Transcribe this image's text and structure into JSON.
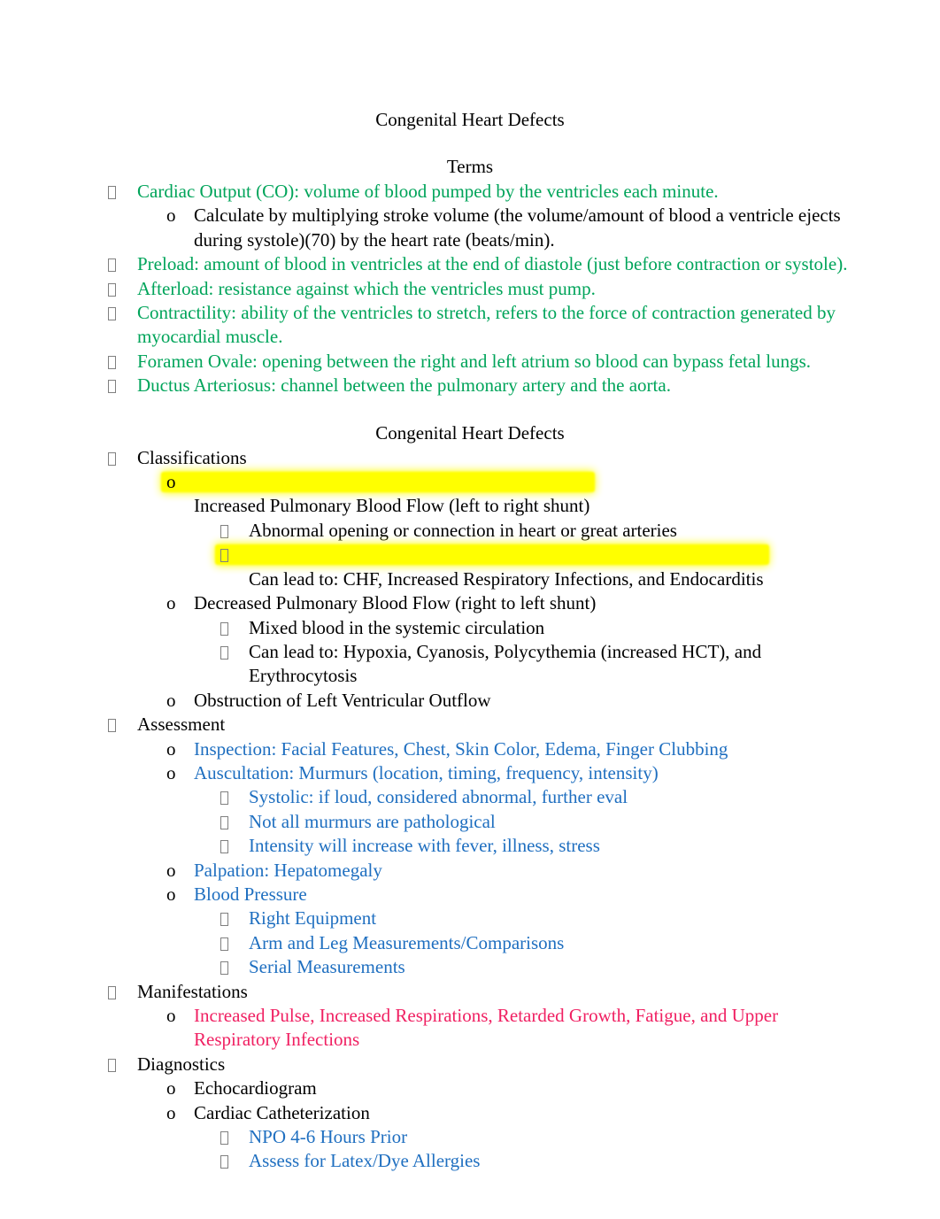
{
  "document": {
    "title": "Congenital Heart Defects",
    "colors": {
      "black": "#000000",
      "green": "#00a45a",
      "blue": "#1f6fc0",
      "pink": "#f02062",
      "highlight": "#ffff00"
    },
    "bullet_glyph_name": "wingdings-missing-glyph-box",
    "sublevel_marker": "o"
  },
  "headings": {
    "main_title": "Congenital Heart Defects",
    "terms_title": "Terms",
    "section_title": "Congenital Heart Defects"
  },
  "terms": {
    "items": [
      {
        "level": 1,
        "color": "green",
        "text": "Cardiac Output (CO): volume of blood pumped by the ventricles each minute."
      },
      {
        "level": 2,
        "color": "black",
        "text": "Calculate by multiplying stroke volume (the volume/amount of blood a ventricle ejects during systole)(70) by the heart rate (beats/min)."
      },
      {
        "level": 1,
        "color": "green",
        "text": "Preload:  amount of blood in ventricles at the end of diastole (just before contraction or systole)."
      },
      {
        "level": 1,
        "color": "green",
        "text": "Afterload: resistance against which the ventricles must pump."
      },
      {
        "level": 1,
        "color": "green",
        "text": "Contractility: ability of the ventricles to stretch, refers to the force of contraction generated by myocardial muscle."
      },
      {
        "level": 1,
        "color": "green",
        "text": "Foramen Ovale: opening between the right and left atrium so blood can bypass fetal lungs."
      },
      {
        "level": 1,
        "color": "green",
        "text": "Ductus Arteriosus:  channel between the pulmonary artery and the aorta."
      }
    ]
  },
  "defects": {
    "items": [
      {
        "level": 1,
        "color": "black",
        "highlight": false,
        "text": "Classifications"
      },
      {
        "level": 2,
        "color": "black",
        "highlight": true,
        "text": "Increased Pulmonary Blood Flow (left to right shunt)"
      },
      {
        "level": 3,
        "color": "black",
        "highlight": false,
        "text": "Abnormal opening or connection in heart or great arteries"
      },
      {
        "level": 3,
        "color": "black",
        "highlight": true,
        "text": "Can lead to: CHF, Increased Respiratory Infections, and Endocarditis"
      },
      {
        "level": 2,
        "color": "black",
        "highlight": false,
        "text": "Decreased Pulmonary Blood Flow (right to left shunt)"
      },
      {
        "level": 3,
        "color": "black",
        "highlight": false,
        "text": "Mixed blood in the systemic circulation"
      },
      {
        "level": 3,
        "color": "black",
        "highlight": false,
        "text": "Can lead to: Hypoxia, Cyanosis, Polycythemia (increased HCT), and Erythrocytosis"
      },
      {
        "level": 2,
        "color": "black",
        "highlight": false,
        "text": "Obstruction of Left Ventricular Outflow"
      },
      {
        "level": 1,
        "color": "black",
        "highlight": false,
        "text": "Assessment"
      },
      {
        "level": 2,
        "color": "blue",
        "highlight": false,
        "text": "Inspection: Facial Features, Chest, Skin Color, Edema, Finger Clubbing"
      },
      {
        "level": 2,
        "color": "blue",
        "highlight": false,
        "text": "Auscultation: Murmurs (location, timing, frequency, intensity)"
      },
      {
        "level": 3,
        "color": "blue",
        "highlight": false,
        "text": "Systolic: if loud, considered abnormal, further eval"
      },
      {
        "level": 3,
        "color": "blue",
        "highlight": false,
        "text": "Not all murmurs are pathological"
      },
      {
        "level": 3,
        "color": "blue",
        "highlight": false,
        "text": "Intensity will increase with fever, illness, stress"
      },
      {
        "level": 2,
        "color": "blue",
        "highlight": false,
        "text": "Palpation: Hepatomegaly"
      },
      {
        "level": 2,
        "color": "blue",
        "highlight": false,
        "text": "Blood Pressure"
      },
      {
        "level": 3,
        "color": "blue",
        "highlight": false,
        "text": "Right Equipment"
      },
      {
        "level": 3,
        "color": "blue",
        "highlight": false,
        "text": "Arm and Leg Measurements/Comparisons"
      },
      {
        "level": 3,
        "color": "blue",
        "highlight": false,
        "text": "Serial Measurements"
      },
      {
        "level": 1,
        "color": "black",
        "highlight": false,
        "text": "Manifestations"
      },
      {
        "level": 2,
        "color": "pink",
        "highlight": false,
        "text": "Increased Pulse, Increased Respirations, Retarded Growth, Fatigue, and Upper Respiratory Infections"
      },
      {
        "level": 1,
        "color": "black",
        "highlight": false,
        "text": "Diagnostics"
      },
      {
        "level": 2,
        "color": "black",
        "highlight": false,
        "text": "Echocardiogram"
      },
      {
        "level": 2,
        "color": "black",
        "highlight": false,
        "text": "Cardiac Catheterization"
      },
      {
        "level": 3,
        "color": "blue",
        "highlight": false,
        "text": "NPO 4-6 Hours Prior"
      },
      {
        "level": 3,
        "color": "blue",
        "highlight": false,
        "text": "Assess for Latex/Dye Allergies"
      }
    ]
  }
}
